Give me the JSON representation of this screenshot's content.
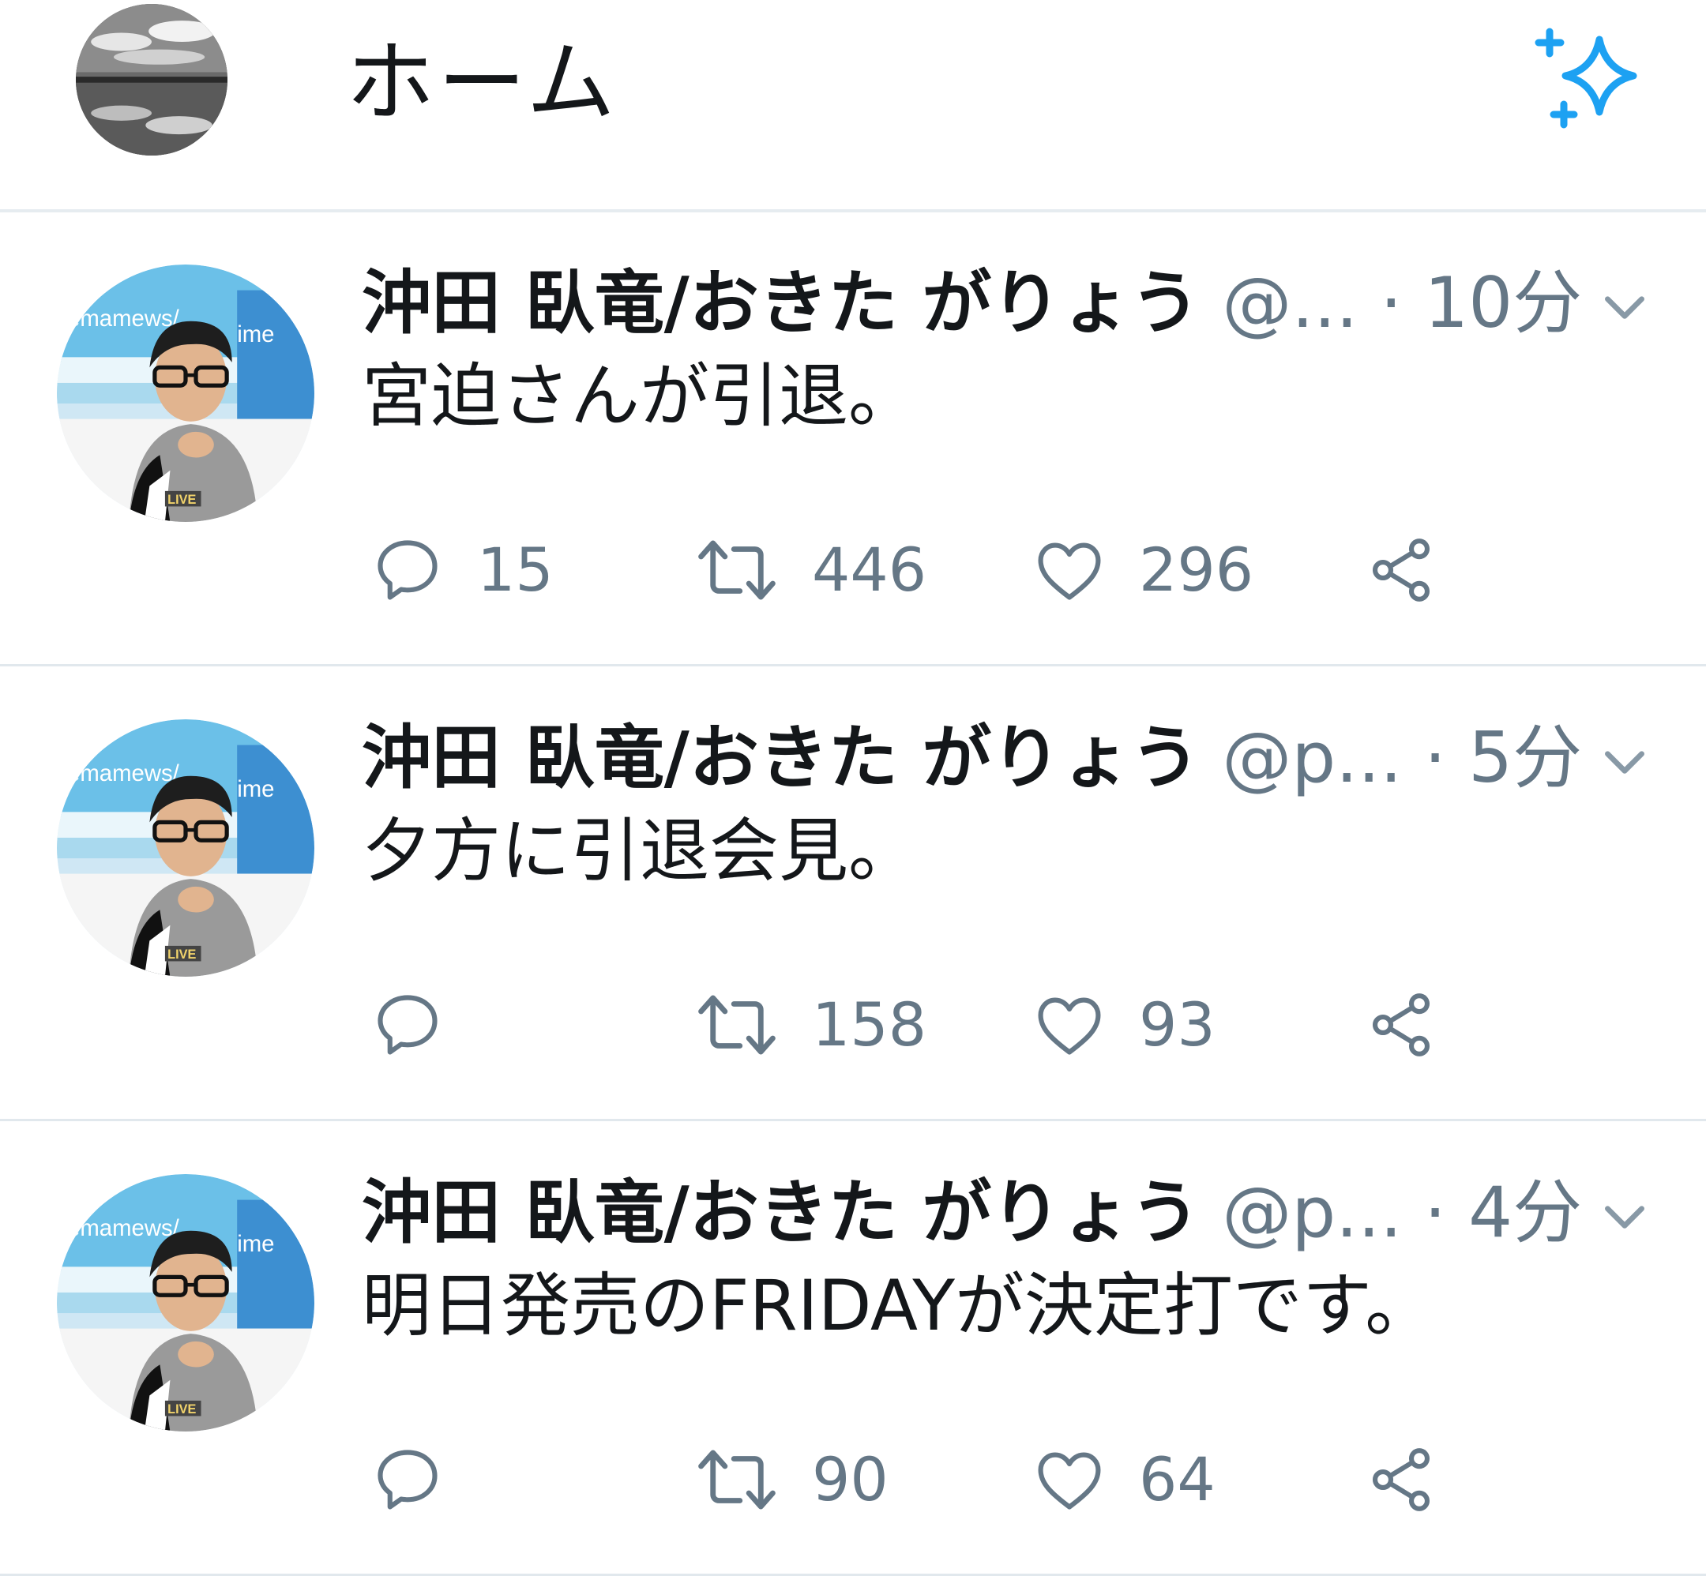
{
  "header": {
    "title": "ホーム",
    "icons": {
      "avatar": "profile-avatar",
      "sparkle": "sparkle-icon"
    },
    "accent_color": "#1da1f2"
  },
  "tweets": [
    {
      "display_name": "沖田 臥竜/おきた がりょう",
      "handle": "@...",
      "separator": "·",
      "time": "10分",
      "text": "宮迫さんが引退。",
      "reply_count": "15",
      "retweet_count": "446",
      "like_count": "296"
    },
    {
      "display_name": "沖田 臥竜/おきた がりょう",
      "handle": "@p...",
      "separator": "·",
      "time": "5分",
      "text": "夕方に引退会見。",
      "reply_count": "",
      "retweet_count": "158",
      "like_count": "93"
    },
    {
      "display_name": "沖田 臥竜/おきた がりょう",
      "handle": "@p...",
      "separator": "·",
      "time": "4分",
      "text": "明日発売のFRIDAYが決定打です。",
      "reply_count": "",
      "retweet_count": "90",
      "like_count": "64"
    }
  ],
  "action_icons": [
    "reply-icon",
    "retweet-icon",
    "like-icon",
    "share-icon"
  ],
  "colors": {
    "text_primary": "#14171a",
    "text_secondary": "#657786",
    "divider": "#e1e8ed"
  }
}
